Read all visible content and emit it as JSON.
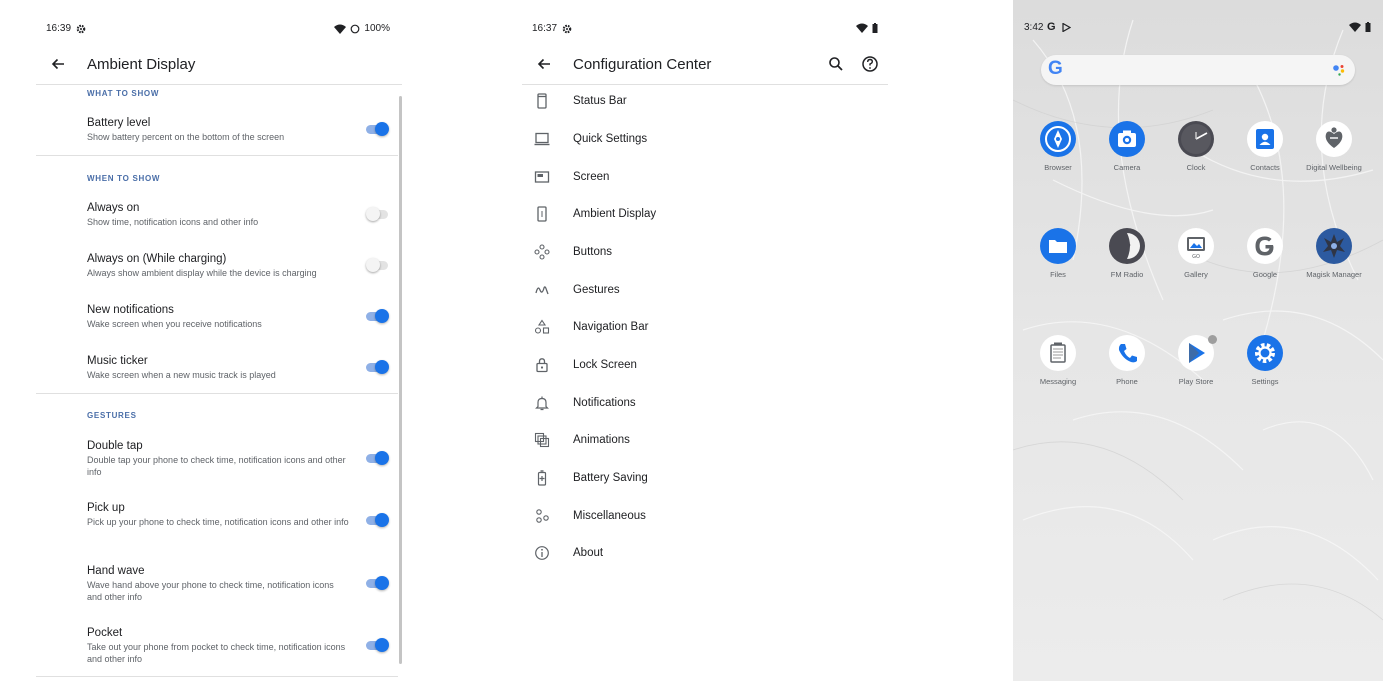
{
  "ambient": {
    "status": {
      "time": "16:39",
      "battery": "100%"
    },
    "title": "Ambient Display",
    "sections": {
      "what": "WHAT TO SHOW",
      "when": "WHEN TO SHOW",
      "gestures": "GESTURES"
    },
    "items": [
      {
        "title": "Battery level",
        "subtitle": "Show battery percent on the bottom of the screen",
        "on": true
      },
      {
        "title": "Always on",
        "subtitle": "Show time, notification icons and other info",
        "on": false
      },
      {
        "title": "Always on (While charging)",
        "subtitle": "Always show ambient display while the device is charging",
        "on": false
      },
      {
        "title": "New notifications",
        "subtitle": "Wake screen when you receive notifications",
        "on": true
      },
      {
        "title": "Music ticker",
        "subtitle": "Wake screen when a new music track is played",
        "on": true
      },
      {
        "title": "Double tap",
        "subtitle": "Double tap your phone to check time, notification icons and other info",
        "on": true
      },
      {
        "title": "Pick up",
        "subtitle": "Pick up your phone to check time, notification icons and other info",
        "on": true
      },
      {
        "title": "Hand wave",
        "subtitle": "Wave hand above your phone to check time, notification icons and other info",
        "on": true
      },
      {
        "title": "Pocket",
        "subtitle": "Take out your phone from pocket to check time, notification icons and other info",
        "on": true
      }
    ]
  },
  "config": {
    "status": {
      "time": "16:37"
    },
    "title": "Configuration Center",
    "items": [
      {
        "label": "Status Bar",
        "icon": "phone-icon"
      },
      {
        "label": "Quick Settings",
        "icon": "laptop-icon"
      },
      {
        "label": "Screen",
        "icon": "screen-icon"
      },
      {
        "label": "Ambient Display",
        "icon": "ambient-phone-icon"
      },
      {
        "label": "Buttons",
        "icon": "buttons-icon"
      },
      {
        "label": "Gestures",
        "icon": "gesture-icon"
      },
      {
        "label": "Navigation Bar",
        "icon": "shapes-icon"
      },
      {
        "label": "Lock Screen",
        "icon": "lock-icon"
      },
      {
        "label": "Notifications",
        "icon": "bell-icon"
      },
      {
        "label": "Animations",
        "icon": "animation-icon"
      },
      {
        "label": "Battery Saving",
        "icon": "battery-icon"
      },
      {
        "label": "Miscellaneous",
        "icon": "misc-icon"
      },
      {
        "label": "About",
        "icon": "info-icon"
      }
    ]
  },
  "home": {
    "status": {
      "time": "3:42"
    },
    "search": {
      "logo": "G"
    },
    "apps": [
      {
        "label": "Browser",
        "icon": "browser-icon",
        "color": "#1a73e8"
      },
      {
        "label": "Camera",
        "icon": "camera-icon",
        "color": "#1a73e8"
      },
      {
        "label": "Clock",
        "icon": "clock-icon",
        "color": "#4a4a52"
      },
      {
        "label": "Contacts",
        "icon": "contacts-icon",
        "color": "#1a73e8"
      },
      {
        "label": "Digital Wellbeing",
        "icon": "wellbeing-icon",
        "color": "#ffffff"
      },
      {
        "label": "Files",
        "icon": "files-icon",
        "color": "#1a73e8"
      },
      {
        "label": "FM Radio",
        "icon": "fm-radio-icon",
        "color": "#4a4a52"
      },
      {
        "label": "Gallery",
        "icon": "gallery-icon",
        "color": "#ffffff"
      },
      {
        "label": "Google",
        "icon": "google-icon",
        "color": "#ffffff"
      },
      {
        "label": "Magisk Manager",
        "icon": "magisk-icon",
        "color": "#2c5aa0"
      },
      {
        "label": "Messaging",
        "icon": "messaging-icon",
        "color": "#ffffff"
      },
      {
        "label": "Phone",
        "icon": "phone-call-icon",
        "color": "#ffffff"
      },
      {
        "label": "Play Store",
        "icon": "play-store-icon",
        "color": "#ffffff"
      },
      {
        "label": "Settings",
        "icon": "settings-icon",
        "color": "#1a73e8"
      }
    ]
  }
}
